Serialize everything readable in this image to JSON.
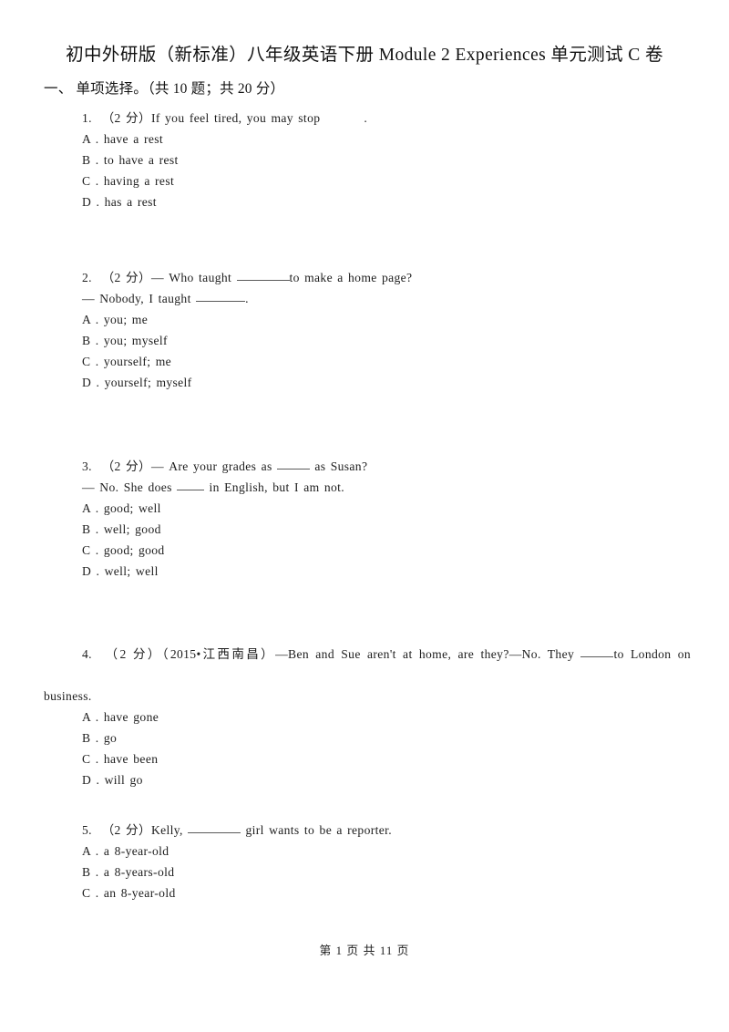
{
  "document": {
    "title": "初中外研版（新标准）八年级英语下册 Module 2 Experiences 单元测试 C 卷",
    "footer": "第 1 页 共 11 页"
  },
  "section": {
    "heading": "一、 单项选择。（共 10 题；共 20 分）"
  },
  "questions": [
    {
      "number": "1.",
      "marks": "（2 分）",
      "stem_before": "If you feel tired, you may stop",
      "stem_after": ".",
      "options": [
        {
          "label": "A .",
          "text": "have a rest"
        },
        {
          "label": "B .",
          "text": "to have a rest"
        },
        {
          "label": "C .",
          "text": "having a rest"
        },
        {
          "label": "D .",
          "text": "has a rest"
        }
      ]
    },
    {
      "number": "2.",
      "marks": "（2 分）",
      "stem_before": "— Who taught",
      "stem_after": "to make a home page?",
      "stem_line2_before": "— Nobody, I taught",
      "stem_line2_after": ".",
      "options": [
        {
          "label": "A .",
          "text": "you; me"
        },
        {
          "label": "B .",
          "text": "you; myself"
        },
        {
          "label": "C .",
          "text": "yourself; me"
        },
        {
          "label": "D .",
          "text": "yourself; myself"
        }
      ]
    },
    {
      "number": "3.",
      "marks": "（2 分）",
      "stem_before": "— Are your grades as",
      "stem_after": "as Susan?",
      "stem_line2_before": "— No. She does",
      "stem_line2_after": "in English, but I am not.",
      "options": [
        {
          "label": "A .",
          "text": "good; well"
        },
        {
          "label": "B .",
          "text": "well; good"
        },
        {
          "label": "C .",
          "text": "good; good"
        },
        {
          "label": "D .",
          "text": "well; well"
        }
      ]
    },
    {
      "number": "4.",
      "marks": "（2 分）",
      "source_tag": "（2015•江西南昌）",
      "stem_before": "—Ben and Sue aren't at home, are they?—No. They",
      "stem_after": "to London on",
      "stem_line2": "business.",
      "options": [
        {
          "label": "A .",
          "text": "have gone"
        },
        {
          "label": "B .",
          "text": "go"
        },
        {
          "label": "C .",
          "text": "have been"
        },
        {
          "label": "D .",
          "text": "will go"
        }
      ]
    },
    {
      "number": "5.",
      "marks": "（2 分）",
      "stem_before": "Kelly,",
      "stem_after": "girl wants to be a reporter.",
      "options": [
        {
          "label": "A .",
          "text": "a 8-year-old"
        },
        {
          "label": "B .",
          "text": "a 8-years-old"
        },
        {
          "label": "C .",
          "text": "an 8-year-old"
        }
      ]
    }
  ]
}
